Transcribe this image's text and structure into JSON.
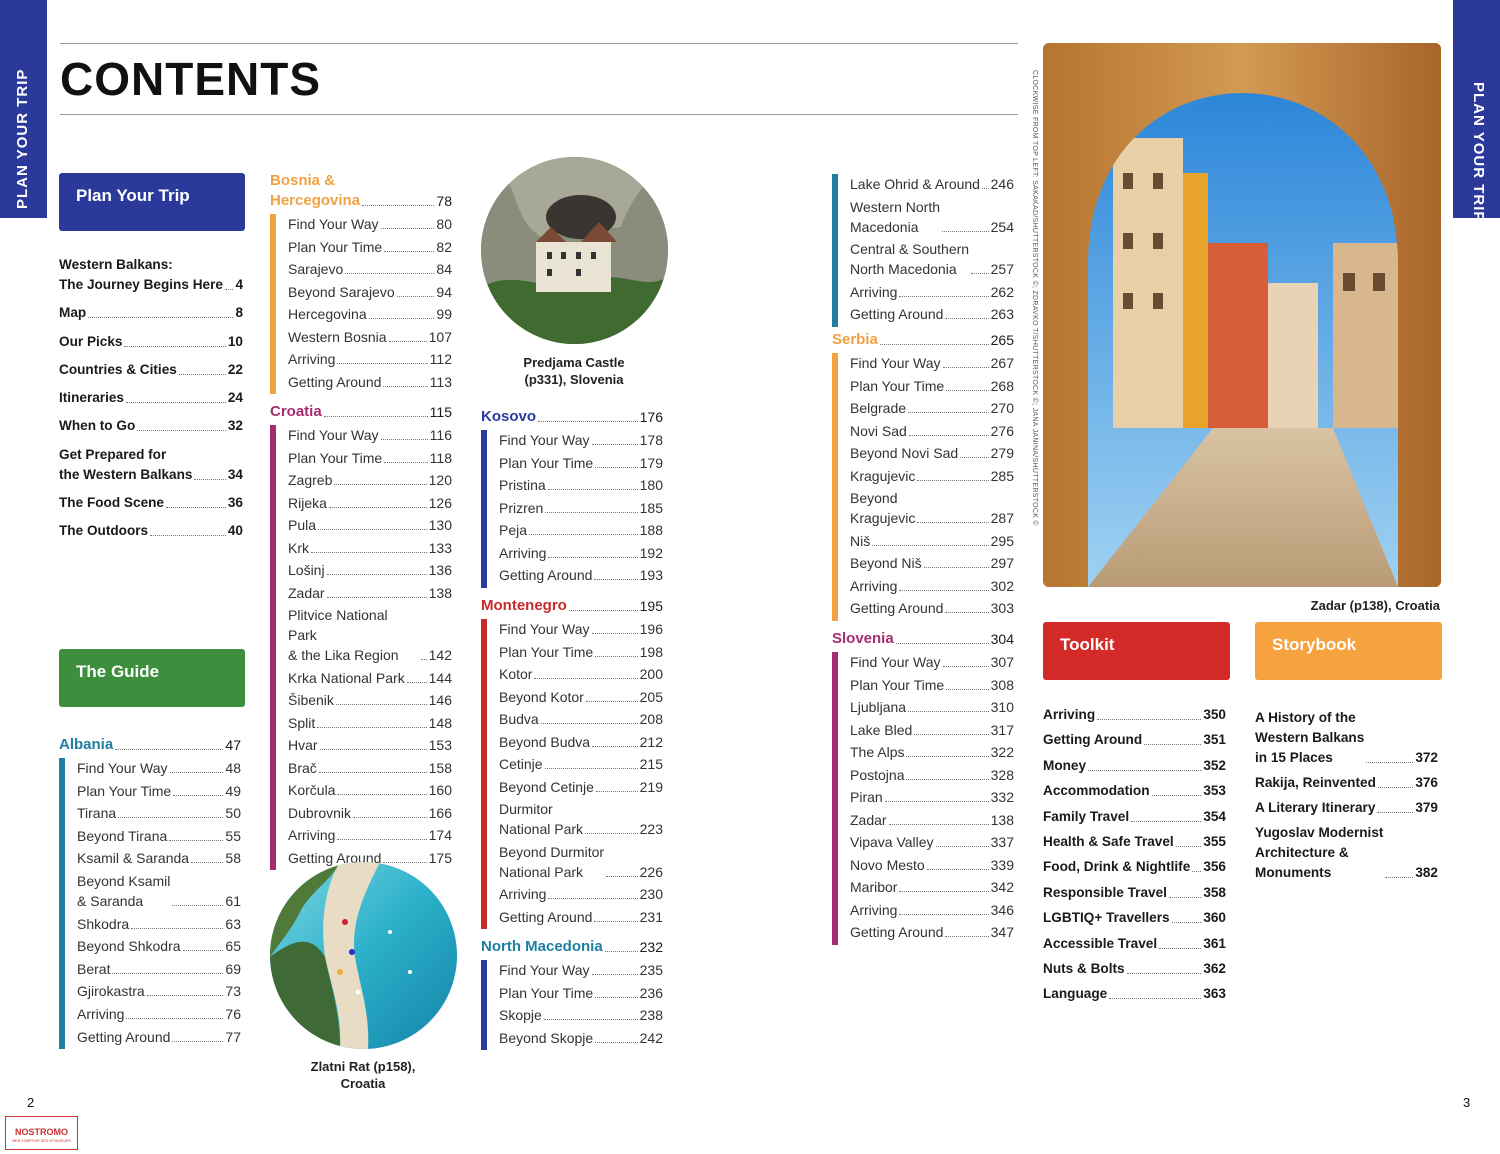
{
  "side_tab_text": "PLAN YOUR TRIP",
  "title": "CONTENTS",
  "colors": {
    "navy": "#2b3a9a",
    "green": "#3d8f3d",
    "teal": "#1f7fa0",
    "orange": "#f0a143",
    "magenta": "#a42c6f",
    "red": "#c62a2a",
    "blue": "#2a3a9e"
  },
  "plan_your_trip": {
    "label": "Plan Your Trip",
    "entries": [
      {
        "label": "Western Balkans:\nThe Journey Begins Here",
        "page": "4"
      },
      {
        "label": "Map",
        "page": "8"
      },
      {
        "label": "Our Picks",
        "page": "10"
      },
      {
        "label": "Countries & Cities",
        "page": "22"
      },
      {
        "label": "Itineraries",
        "page": "24"
      },
      {
        "label": "When to Go",
        "page": "32"
      },
      {
        "label": "Get Prepared for\nthe Western Balkans",
        "page": "34"
      },
      {
        "label": "The Food Scene",
        "page": "36"
      },
      {
        "label": "The Outdoors",
        "page": "40"
      }
    ]
  },
  "the_guide": {
    "label": "The Guide"
  },
  "albania": {
    "label": "Albania",
    "page": "47",
    "entries": [
      {
        "label": "Find Your Way",
        "page": "48"
      },
      {
        "label": "Plan Your Time",
        "page": "49"
      },
      {
        "label": "Tirana",
        "page": "50"
      },
      {
        "label": "Beyond Tirana",
        "page": "55"
      },
      {
        "label": "Ksamil & Saranda",
        "page": "58"
      },
      {
        "label": "Beyond Ksamil\n& Saranda",
        "page": "61"
      },
      {
        "label": "Shkodra",
        "page": "63"
      },
      {
        "label": "Beyond Shkodra",
        "page": "65"
      },
      {
        "label": "Berat",
        "page": "69"
      },
      {
        "label": "Gjirokastra",
        "page": "73"
      },
      {
        "label": "Arriving",
        "page": "76"
      },
      {
        "label": "Getting Around",
        "page": "77"
      }
    ]
  },
  "bosnia": {
    "label": "Bosnia &\nHercegovina",
    "page": "78",
    "entries": [
      {
        "label": "Find Your Way",
        "page": "80"
      },
      {
        "label": "Plan Your Time",
        "page": "82"
      },
      {
        "label": "Sarajevo",
        "page": "84"
      },
      {
        "label": "Beyond Sarajevo",
        "page": "94"
      },
      {
        "label": "Hercegovina",
        "page": "99"
      },
      {
        "label": "Western Bosnia",
        "page": "107"
      },
      {
        "label": "Arriving",
        "page": "112"
      },
      {
        "label": "Getting Around",
        "page": "113"
      }
    ]
  },
  "croatia": {
    "label": "Croatia",
    "page": "115",
    "entries": [
      {
        "label": "Find Your Way",
        "page": "116"
      },
      {
        "label": "Plan Your Time",
        "page": "118"
      },
      {
        "label": "Zagreb",
        "page": "120"
      },
      {
        "label": "Rijeka",
        "page": "126"
      },
      {
        "label": "Pula",
        "page": "130"
      },
      {
        "label": "Krk",
        "page": "133"
      },
      {
        "label": "Lošinj",
        "page": "136"
      },
      {
        "label": "Zadar",
        "page": "138"
      },
      {
        "label": "Plitvice National Park\n& the Lika Region",
        "page": "142"
      },
      {
        "label": "Krka National Park",
        "page": "144"
      },
      {
        "label": "Šibenik",
        "page": "146"
      },
      {
        "label": "Split",
        "page": "148"
      },
      {
        "label": "Hvar",
        "page": "153"
      },
      {
        "label": "Brač",
        "page": "158"
      },
      {
        "label": "Korčula",
        "page": "160"
      },
      {
        "label": "Dubrovnik",
        "page": "166"
      },
      {
        "label": "Arriving",
        "page": "174"
      },
      {
        "label": "Getting Around",
        "page": "175"
      }
    ]
  },
  "kosovo": {
    "label": "Kosovo",
    "page": "176",
    "entries": [
      {
        "label": "Find Your Way",
        "page": "178"
      },
      {
        "label": "Plan Your Time",
        "page": "179"
      },
      {
        "label": "Pristina",
        "page": "180"
      },
      {
        "label": "Prizren",
        "page": "185"
      },
      {
        "label": "Peja",
        "page": "188"
      },
      {
        "label": "Arriving",
        "page": "192"
      },
      {
        "label": "Getting Around",
        "page": "193"
      }
    ]
  },
  "montenegro": {
    "label": "Montenegro",
    "page": "195",
    "entries": [
      {
        "label": "Find Your Way",
        "page": "196"
      },
      {
        "label": "Plan Your Time",
        "page": "198"
      },
      {
        "label": "Kotor",
        "page": "200"
      },
      {
        "label": "Beyond Kotor",
        "page": "205"
      },
      {
        "label": "Budva",
        "page": "208"
      },
      {
        "label": "Beyond Budva",
        "page": "212"
      },
      {
        "label": "Cetinje",
        "page": "215"
      },
      {
        "label": "Beyond Cetinje",
        "page": "219"
      },
      {
        "label": "Durmitor\nNational Park",
        "page": "223"
      },
      {
        "label": "Beyond Durmitor\nNational Park",
        "page": "226"
      },
      {
        "label": "Arriving",
        "page": "230"
      },
      {
        "label": "Getting Around",
        "page": "231"
      }
    ]
  },
  "north_macedonia": {
    "label": "North Macedonia",
    "page": "232",
    "entries": [
      {
        "label": "Find Your Way",
        "page": "235"
      },
      {
        "label": "Plan Your Time",
        "page": "236"
      },
      {
        "label": "Skopje",
        "page": "238"
      },
      {
        "label": "Beyond Skopje",
        "page": "242"
      }
    ]
  },
  "north_macedonia_cont": {
    "entries": [
      {
        "label": "Lake Ohrid & Around",
        "page": "246"
      },
      {
        "label": "Western North\nMacedonia",
        "page": "254"
      },
      {
        "label": "Central & Southern\nNorth Macedonia",
        "page": "257"
      },
      {
        "label": "Arriving",
        "page": "262"
      },
      {
        "label": "Getting Around",
        "page": "263"
      }
    ]
  },
  "serbia": {
    "label": "Serbia",
    "page": "265",
    "entries": [
      {
        "label": "Find Your Way",
        "page": "267"
      },
      {
        "label": "Plan Your Time",
        "page": "268"
      },
      {
        "label": "Belgrade",
        "page": "270"
      },
      {
        "label": "Novi Sad",
        "page": "276"
      },
      {
        "label": "Beyond Novi Sad",
        "page": "279"
      },
      {
        "label": "Kragujevic",
        "page": "285"
      },
      {
        "label": "Beyond\nKragujevic",
        "page": "287"
      },
      {
        "label": "Niš",
        "page": "295"
      },
      {
        "label": "Beyond Niš",
        "page": "297"
      },
      {
        "label": "Arriving",
        "page": "302"
      },
      {
        "label": "Getting Around",
        "page": "303"
      }
    ]
  },
  "slovenia": {
    "label": "Slovenia",
    "page": "304",
    "entries": [
      {
        "label": "Find Your Way",
        "page": "307"
      },
      {
        "label": "Plan Your Time",
        "page": "308"
      },
      {
        "label": "Ljubljana",
        "page": "310"
      },
      {
        "label": "Lake Bled",
        "page": "317"
      },
      {
        "label": "The Alps",
        "page": "322"
      },
      {
        "label": "Postojna",
        "page": "328"
      },
      {
        "label": "Piran",
        "page": "332"
      },
      {
        "label": "Zadar",
        "page": "138"
      },
      {
        "label": "Vipava Valley",
        "page": "337"
      },
      {
        "label": "Novo Mesto",
        "page": "339"
      },
      {
        "label": "Maribor",
        "page": "342"
      },
      {
        "label": "Arriving",
        "page": "346"
      },
      {
        "label": "Getting Around",
        "page": "347"
      }
    ]
  },
  "toolkit": {
    "label": "Toolkit",
    "entries": [
      {
        "label": "Arriving",
        "page": "350"
      },
      {
        "label": "Getting Around",
        "page": "351"
      },
      {
        "label": "Money",
        "page": "352"
      },
      {
        "label": "Accommodation",
        "page": "353"
      },
      {
        "label": "Family Travel",
        "page": "354"
      },
      {
        "label": "Health & Safe Travel",
        "page": "355"
      },
      {
        "label": "Food, Drink & Nightlife",
        "page": "356"
      },
      {
        "label": "Responsible Travel",
        "page": "358"
      },
      {
        "label": "LGBTIQ+ Travellers",
        "page": "360"
      },
      {
        "label": "Accessible Travel",
        "page": "361"
      },
      {
        "label": "Nuts & Bolts",
        "page": "362"
      },
      {
        "label": "Language",
        "page": "363"
      }
    ]
  },
  "storybook": {
    "label": "Storybook",
    "entries": [
      {
        "label": "A History of the\nWestern Balkans\nin 15 Places",
        "page": "372"
      },
      {
        "label": "Rakija, Reinvented",
        "page": "376"
      },
      {
        "label": "A Literary Itinerary",
        "page": "379"
      },
      {
        "label": "Yugoslav Modernist\nArchitecture &\nMonuments",
        "page": "382"
      }
    ]
  },
  "captions": {
    "predjama": "Predjama Castle\n(p331), Slovenia",
    "zlatni": "Zlatni Rat (p158),\nCroatia",
    "zadar": "Zadar (p138), Croatia"
  },
  "photo_credit": "CLOCKWISE FROM TOP LEFT: SAKAKAD/SHUTTERSTOCK ©; ZDRAVKO T/SHUTTERSTOCK ©; JANA JANINA/SHUTTERSTOCK ©",
  "page_left": "2",
  "page_right": "3",
  "logo_text": "NOSTROMO",
  "logo_subtext": "WEB COMPTOIR DES VOYAGEURS"
}
